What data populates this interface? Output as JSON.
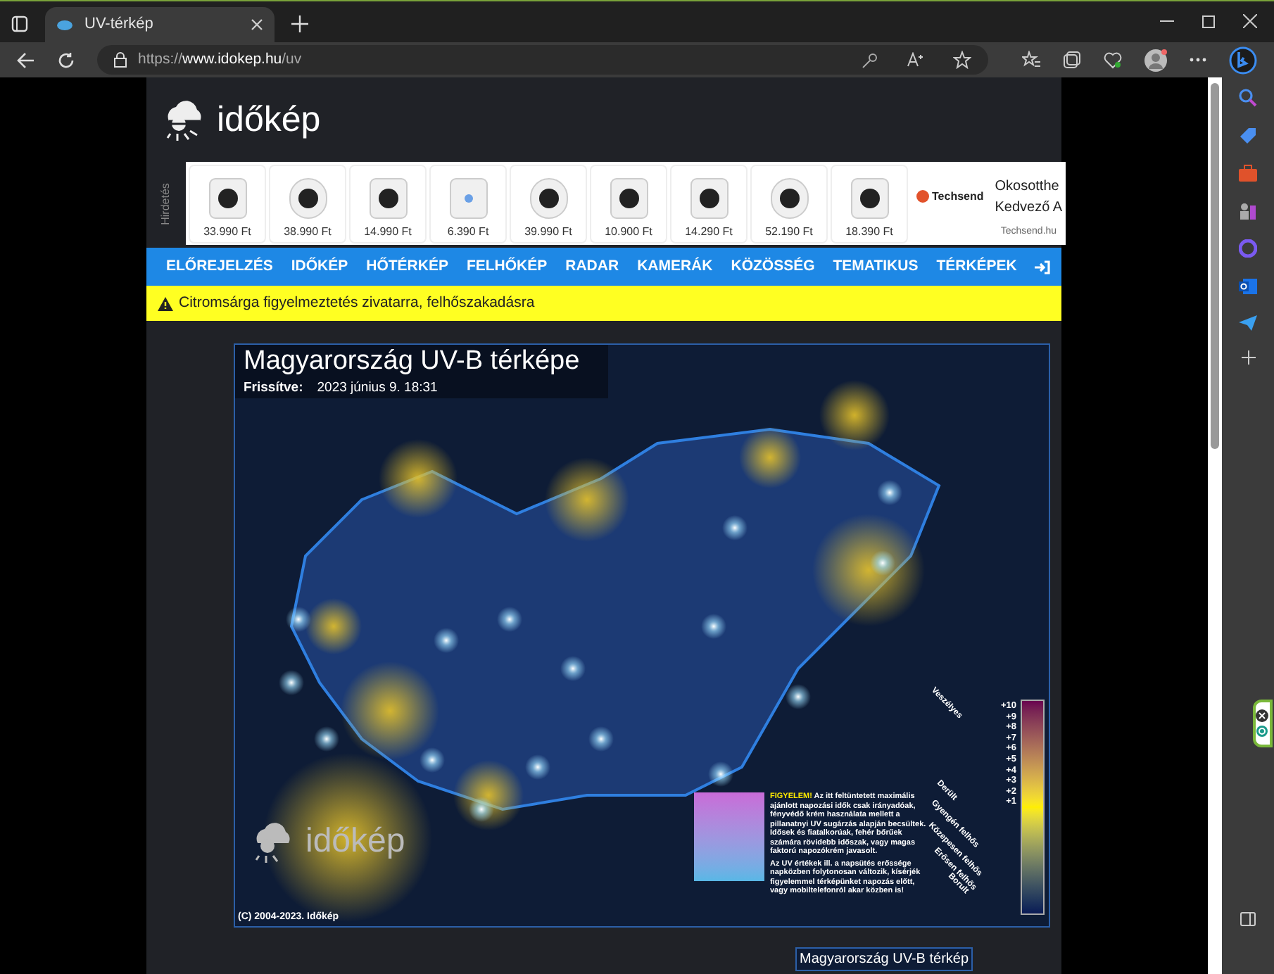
{
  "browser": {
    "tab_title": "UV-térkép",
    "url_prefix": "https://",
    "url_domain": "www.idokep.hu",
    "url_path": "/uv"
  },
  "site": {
    "logo": "időkép"
  },
  "ad": {
    "label": "Hirdetés",
    "products": [
      {
        "price": "33.990 Ft"
      },
      {
        "price": "38.990 Ft"
      },
      {
        "price": "14.990 Ft"
      },
      {
        "price": "6.390 Ft"
      },
      {
        "price": "39.990 Ft"
      },
      {
        "price": "10.900 Ft"
      },
      {
        "price": "14.290 Ft"
      },
      {
        "price": "52.190 Ft"
      },
      {
        "price": "18.390 Ft"
      }
    ],
    "brand": "Techsend",
    "headline_1": "Okosotthe",
    "headline_2": "Kedvező A",
    "domain": "Techsend.hu"
  },
  "nav": [
    {
      "label": "ELŐREJELZÉS"
    },
    {
      "label": "IDŐKÉP"
    },
    {
      "label": "HŐTÉRKÉP"
    },
    {
      "label": "FELHŐKÉP"
    },
    {
      "label": "RADAR"
    },
    {
      "label": "KAMERÁK"
    },
    {
      "label": "KÖZÖSSÉG"
    },
    {
      "label": "TEMATIKUS"
    },
    {
      "label": "TÉRKÉPEK"
    }
  ],
  "alert": {
    "text": "Citromsárga figyelmeztetés zivatarra, felhőszakadásra"
  },
  "map": {
    "title": "Magyarország UV-B térképe",
    "updated_label": "Frissítve:",
    "updated": "2023 június 9. 18:31",
    "logo": "időkép",
    "copyright": "(C) 2004-2023. Időkép",
    "notice": {
      "heading": "FIGYELEM!",
      "paragraphs": [
        "Az itt feltüntetett maximális ajánlott napozási idők csak irányadóak, fényvédő krém használata mellett a pillanatnyi UV sugárzás alapján becsültek. Idősek és fiatalkorúak, fehér bőrűek számára rövidebb időszak, vagy magas faktorú napozókrém javasolt.",
        "Az UV értékek ill. a napsütés erőssége napközben folytonosan változik, kísérjék figyelemmel térképünket napozás előtt, vagy mobiltelefonról akar közben is!"
      ]
    },
    "scale": [
      "+10",
      "+9",
      "+8",
      "+7",
      "+6",
      "+5",
      "+4",
      "+3",
      "+2",
      "+1"
    ],
    "sky": [
      "Veszélyes",
      "Derült",
      "Gyengén felhős",
      "Közepesen felhős",
      "Erősen felhős",
      "Borult"
    ]
  },
  "next_map": {
    "title": "Magyarország UV-B térkép"
  }
}
